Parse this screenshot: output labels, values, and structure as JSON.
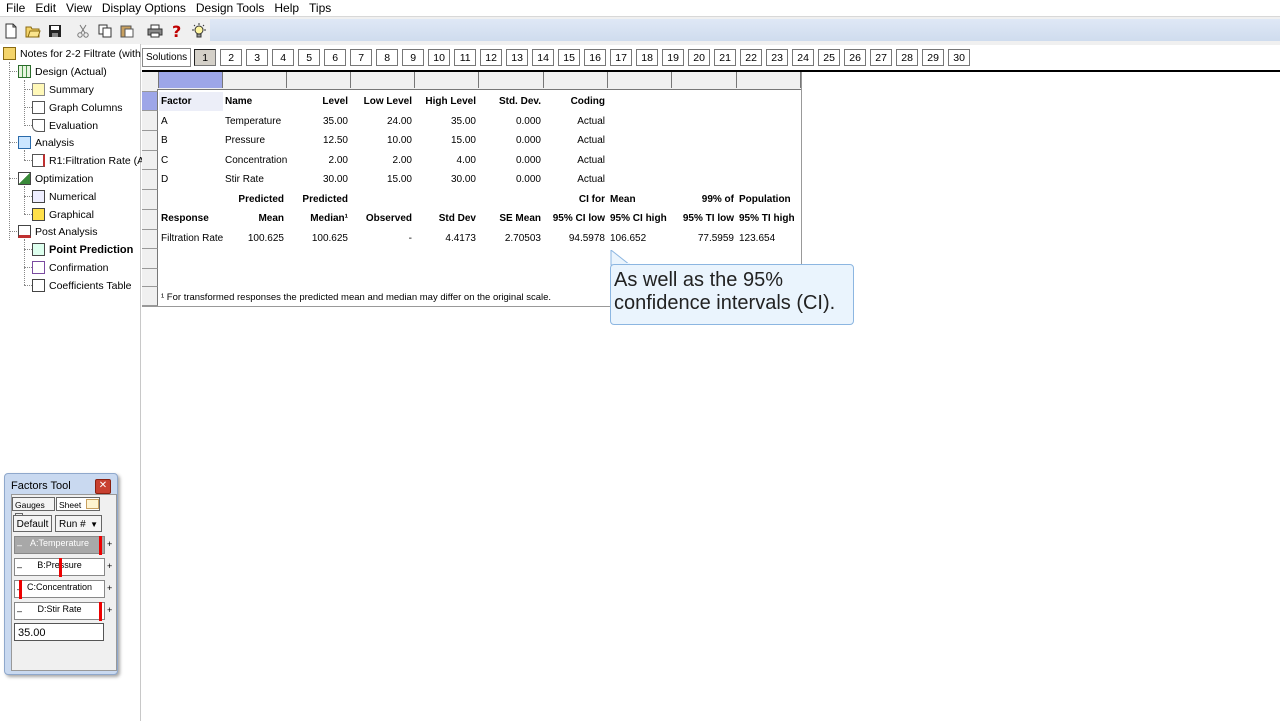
{
  "menu": [
    "File",
    "Edit",
    "View",
    "Display Options",
    "Design Tools",
    "Help",
    "Tips"
  ],
  "tree": {
    "root": "Notes for 2-2 Filtrate (with",
    "design": "Design (Actual)",
    "summary": "Summary",
    "graph_columns": "Graph Columns",
    "evaluation": "Evaluation",
    "analysis": "Analysis",
    "r1": "R1:Filtration Rate (A",
    "optimization": "Optimization",
    "numerical": "Numerical",
    "graphical": "Graphical",
    "post_analysis": "Post Analysis",
    "point_prediction": "Point Prediction",
    "confirmation": "Confirmation",
    "coefficients_table": "Coefficients Table"
  },
  "solutions": {
    "label": "Solutions",
    "tabs": [
      "1",
      "2",
      "3",
      "4",
      "5",
      "6",
      "7",
      "8",
      "9",
      "10",
      "11",
      "12",
      "13",
      "14",
      "15",
      "16",
      "17",
      "18",
      "19",
      "20",
      "21",
      "22",
      "23",
      "24",
      "25",
      "26",
      "27",
      "28",
      "29",
      "30"
    ],
    "selected": "1"
  },
  "factors_header": {
    "factor": "Factor",
    "name": "Name",
    "level": "Level",
    "low": "Low Level",
    "high": "High Level",
    "std": "Std. Dev.",
    "coding": "Coding"
  },
  "factors": [
    {
      "factor": "A",
      "name": "Temperature",
      "level": "35.00",
      "low": "24.00",
      "high": "35.00",
      "std": "0.000",
      "coding": "Actual"
    },
    {
      "factor": "B",
      "name": "Pressure",
      "level": "12.50",
      "low": "10.00",
      "high": "15.00",
      "std": "0.000",
      "coding": "Actual"
    },
    {
      "factor": "C",
      "name": "Concentration",
      "level": "2.00",
      "low": "2.00",
      "high": "4.00",
      "std": "0.000",
      "coding": "Actual"
    },
    {
      "factor": "D",
      "name": "Stir Rate",
      "level": "30.00",
      "low": "15.00",
      "high": "30.00",
      "std": "0.000",
      "coding": "Actual"
    }
  ],
  "response_header_top": {
    "predicted_mean": "Predicted",
    "predicted_median": "Predicted",
    "ci_for": "CI for",
    "mean": "Mean",
    "ti_99": "99% of",
    "population": "Population"
  },
  "response_header": {
    "response": "Response",
    "mean": "Mean",
    "median": "Median¹",
    "observed": "Observed",
    "std_dev": "Std Dev",
    "se_mean": "SE Mean",
    "ci_low": "95% CI low",
    "ci_high": "95% CI high",
    "ti_low": "95% TI low",
    "ti_high": "95% TI high"
  },
  "response_row": {
    "response": "Filtration Rate",
    "mean": "100.625",
    "median": "100.625",
    "observed": "-",
    "std_dev": "4.4173",
    "se_mean": "2.70503",
    "ci_low": "94.5978",
    "ci_high": "106.652",
    "ti_low": "77.5959",
    "ti_high": "123.654"
  },
  "footnote": "¹ For transformed responses the predicted mean and median may differ on the original scale.",
  "callout": "As well as the 95%\nconfidence intervals (CI).",
  "factors_tool": {
    "title": "Factors Tool",
    "tab_gauges": "Gauges",
    "tab_sheet": "Sheet",
    "default_button": "Default",
    "run_button": "Run #",
    "gauges": [
      {
        "label": "A:Temperature",
        "level": 1.0
      },
      {
        "label": "B:Pressure",
        "level": 0.5
      },
      {
        "label": "C:Concentration",
        "level": 0.0
      },
      {
        "label": "D:Stir Rate",
        "level": 1.0
      }
    ],
    "value": "35.00"
  },
  "colors": {
    "selection": "#9da6e8",
    "callout_bg": "#eaf4fd",
    "callout_border": "#8cb6e1",
    "gauge_marker": "#ee0000"
  }
}
